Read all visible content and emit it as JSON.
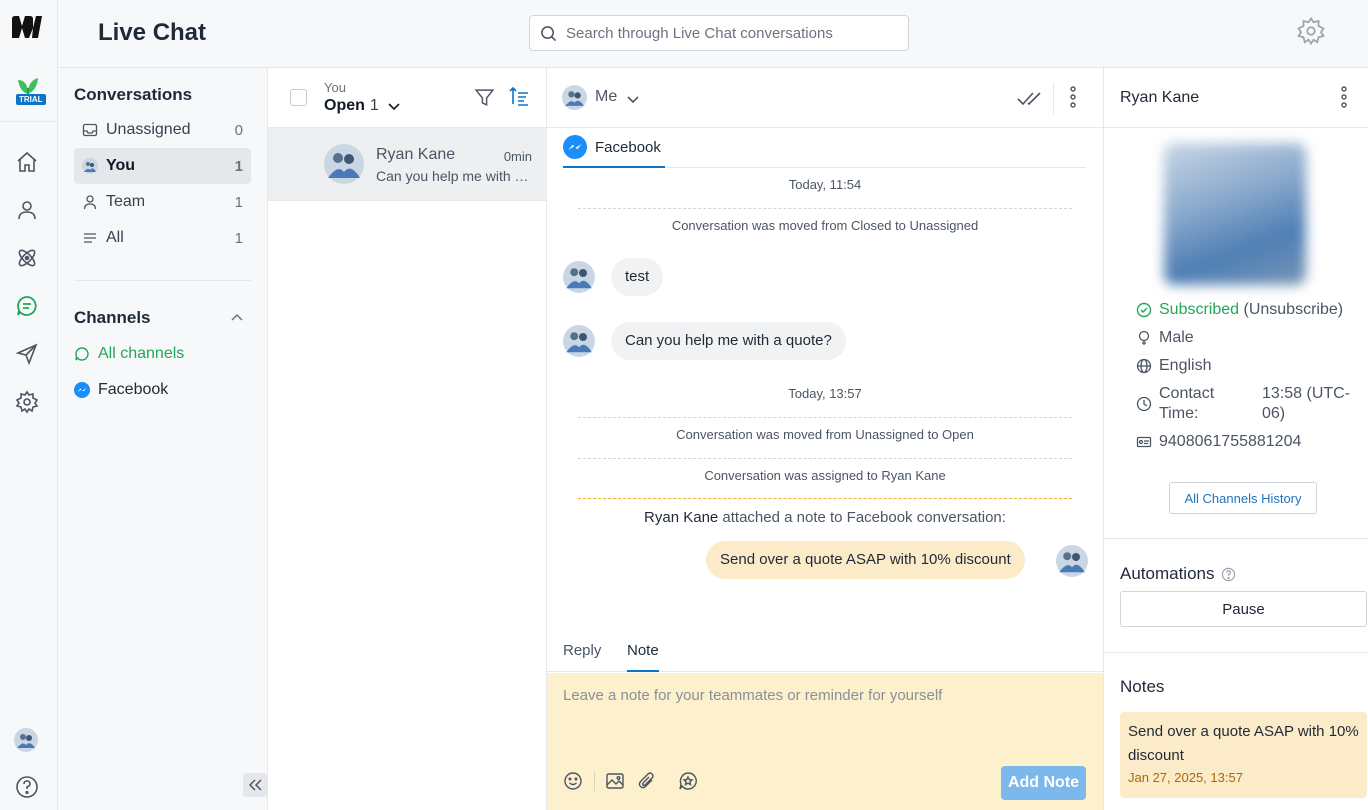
{
  "app": {
    "title": "Live Chat",
    "trial_badge": "TRIAL"
  },
  "search": {
    "placeholder": "Search through Live Chat conversations"
  },
  "rail": {
    "items": [
      "home-icon",
      "contacts-icon",
      "automation-icon",
      "chat-icon",
      "send-icon",
      "settings-icon"
    ],
    "active_color": "#22a65a"
  },
  "sidebar": {
    "conversations_heading": "Conversations",
    "items": [
      {
        "label": "Unassigned",
        "count": "0",
        "icon": "inbox-icon"
      },
      {
        "label": "You",
        "count": "1",
        "icon": "avatar"
      },
      {
        "label": "Team",
        "count": "1",
        "icon": "user-icon"
      },
      {
        "label": "All",
        "count": "1",
        "icon": "list-icon"
      }
    ],
    "channels_heading": "Channels",
    "channels": [
      {
        "label": "All channels",
        "icon": "chat-bubbles-icon"
      },
      {
        "label": "Facebook",
        "icon": "messenger-icon"
      }
    ]
  },
  "convlist": {
    "owner_label": "You",
    "status_label": "Open",
    "status_count": "1",
    "rows": [
      {
        "name": "Ryan Kane",
        "time": "0min",
        "snippet": "Can you help me with a quote?"
      }
    ]
  },
  "chat": {
    "assignee": "Me",
    "channel_tab": "Facebook",
    "stamp1": "Today, 11:54",
    "sys1": "Conversation was moved from Closed to Unassigned",
    "msg1": "test",
    "msg2": "Can you help me with a quote?",
    "stamp2": "Today, 13:57",
    "sys2": "Conversation was moved from Unassigned to Open",
    "sys3": "Conversation was assigned to Ryan Kane",
    "note_author": "Ryan Kane",
    "note_action": " attached a note to Facebook conversation:",
    "note_text": "Send over a quote ASAP with 10% discount",
    "reply_tab": "Reply",
    "note_tab": "Note",
    "composer_placeholder": "Leave a note for your teammates or reminder for yourself",
    "add_note_label": "Add Note"
  },
  "profile": {
    "name": "Ryan Kane",
    "subscribed": "Subscribed",
    "unsubscribe": " (Unsubscribe)",
    "gender": "Male",
    "language": "English",
    "contact_time_label": "Contact Time:",
    "contact_time_value": "13:58 (UTC-06)",
    "id": "9408061755881204",
    "history_button": "All Channels History",
    "automations_heading": "Automations",
    "pause_button": "Pause",
    "notes_heading": "Notes",
    "note_text": "Send over a quote ASAP with 10% discount",
    "note_date": "Jan 27, 2025, 13:57"
  },
  "colors": {
    "accent": "#0b74c7",
    "note": "#fcebc8",
    "success": "#22a65a"
  }
}
